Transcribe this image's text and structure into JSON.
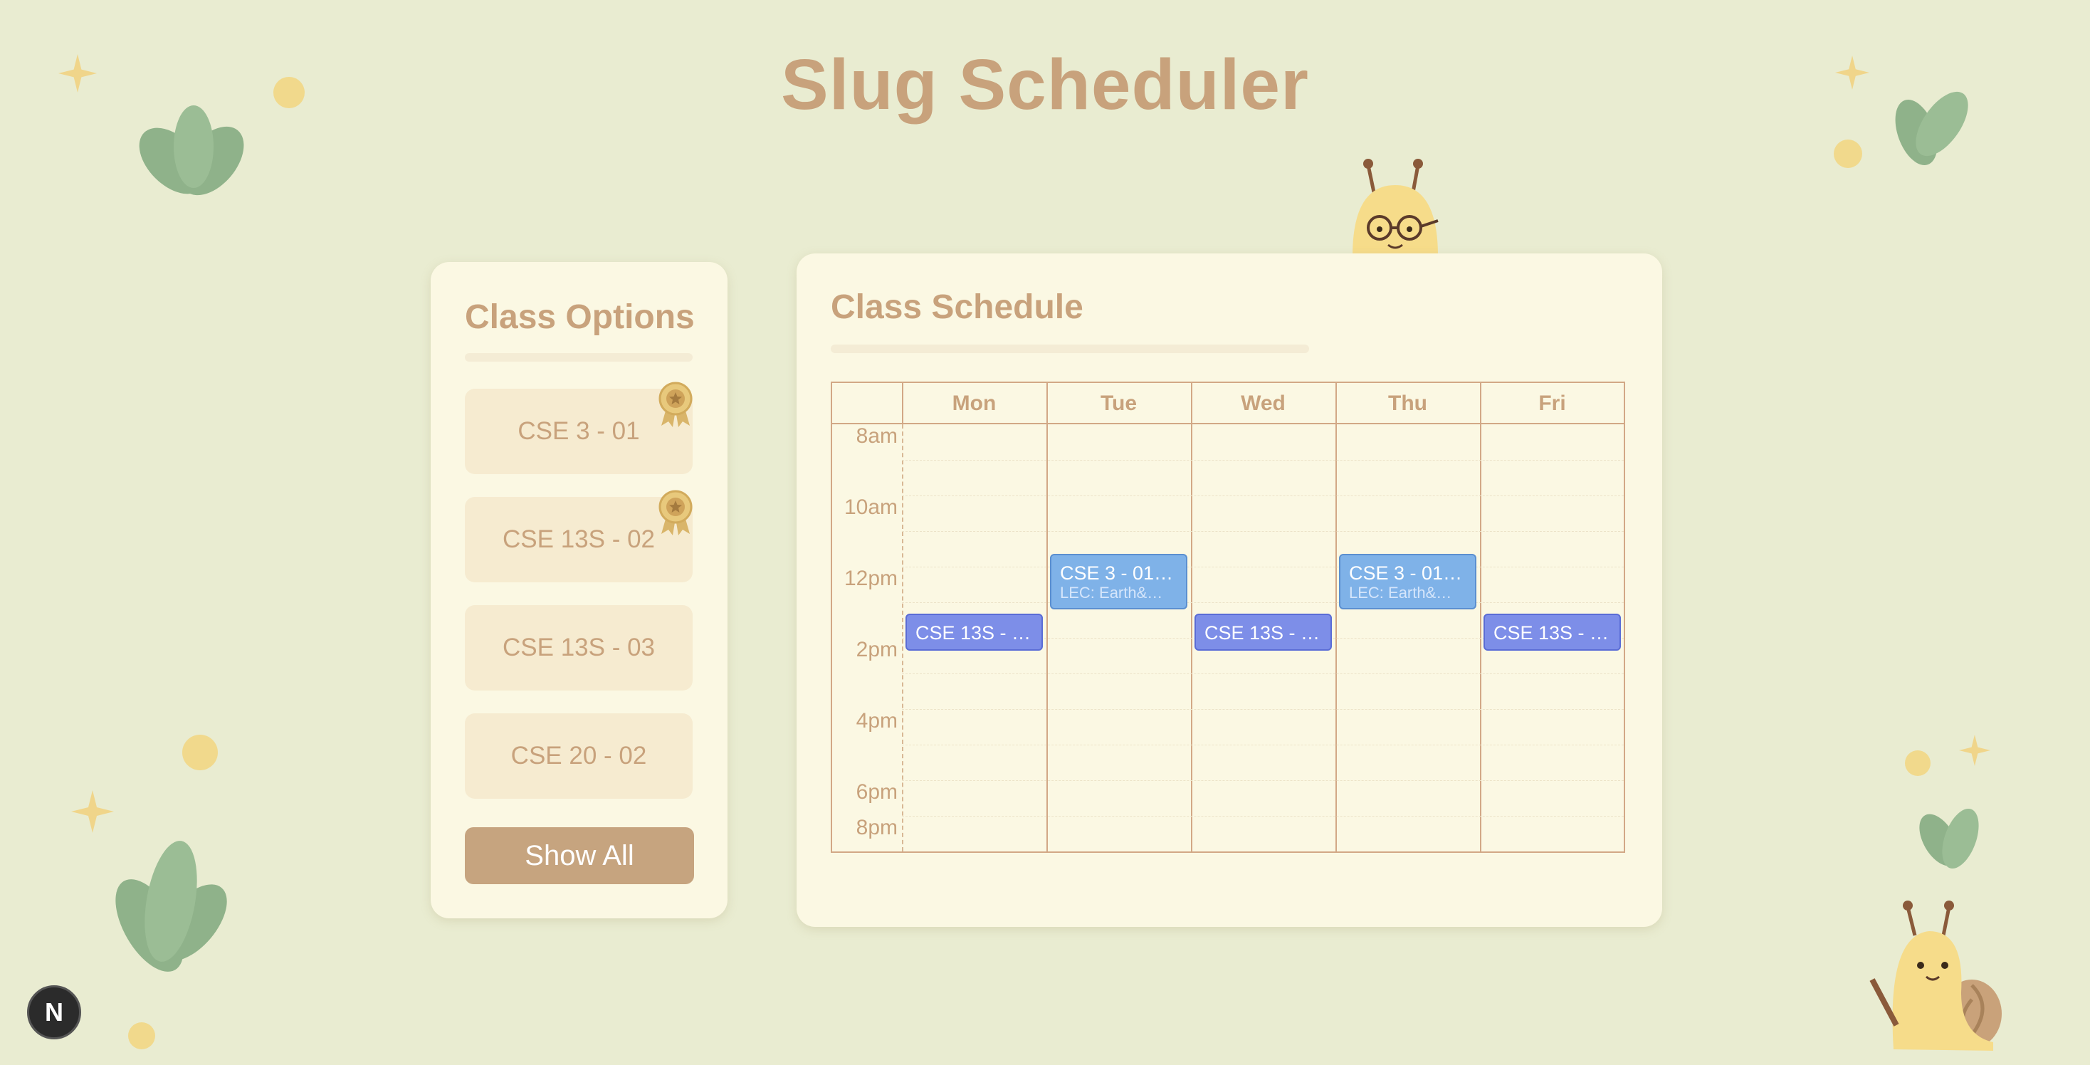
{
  "app": {
    "title": "Slug Scheduler"
  },
  "options": {
    "title": "Class Options",
    "items": [
      {
        "label": "CSE 3 - 01",
        "awarded": true
      },
      {
        "label": "CSE 13S - 02",
        "awarded": true
      },
      {
        "label": "CSE 13S - 03",
        "awarded": false
      },
      {
        "label": "CSE 20 - 02",
        "awarded": false
      }
    ],
    "show_all_label": "Show All"
  },
  "schedule": {
    "title": "Class Schedule",
    "days": [
      "Mon",
      "Tue",
      "Wed",
      "Thu",
      "Fri"
    ],
    "times": [
      "8am",
      "10am",
      "12pm",
      "2pm",
      "4pm",
      "6pm",
      "8pm"
    ],
    "events": [
      {
        "day": "Tue",
        "title": "CSE 3 - 01…",
        "subtitle": "LEC: Earth&…"
      },
      {
        "day": "Thu",
        "title": "CSE 3 - 01…",
        "subtitle": "LEC: Earth&…"
      },
      {
        "day": "Mon",
        "title": "CSE 13S - …",
        "subtitle": ""
      },
      {
        "day": "Wed",
        "title": "CSE 13S - …",
        "subtitle": ""
      },
      {
        "day": "Fri",
        "title": "CSE 13S - …",
        "subtitle": ""
      }
    ]
  },
  "badge": {
    "label": "N"
  },
  "colors": {
    "background": "#e9ecd1",
    "panel": "#fbf8e3",
    "accent_text": "#c8a27c",
    "button": "#c6a47f",
    "event_cse3": "#7fb2e8",
    "event_cse13s": "#7d8ee8",
    "leaf": "#8fb28a"
  },
  "icons": {
    "award": "award-ribbon-icon",
    "leaf": "leaf-icon",
    "sparkle": "sparkle-icon",
    "snail": "snail-mascot-icon"
  }
}
